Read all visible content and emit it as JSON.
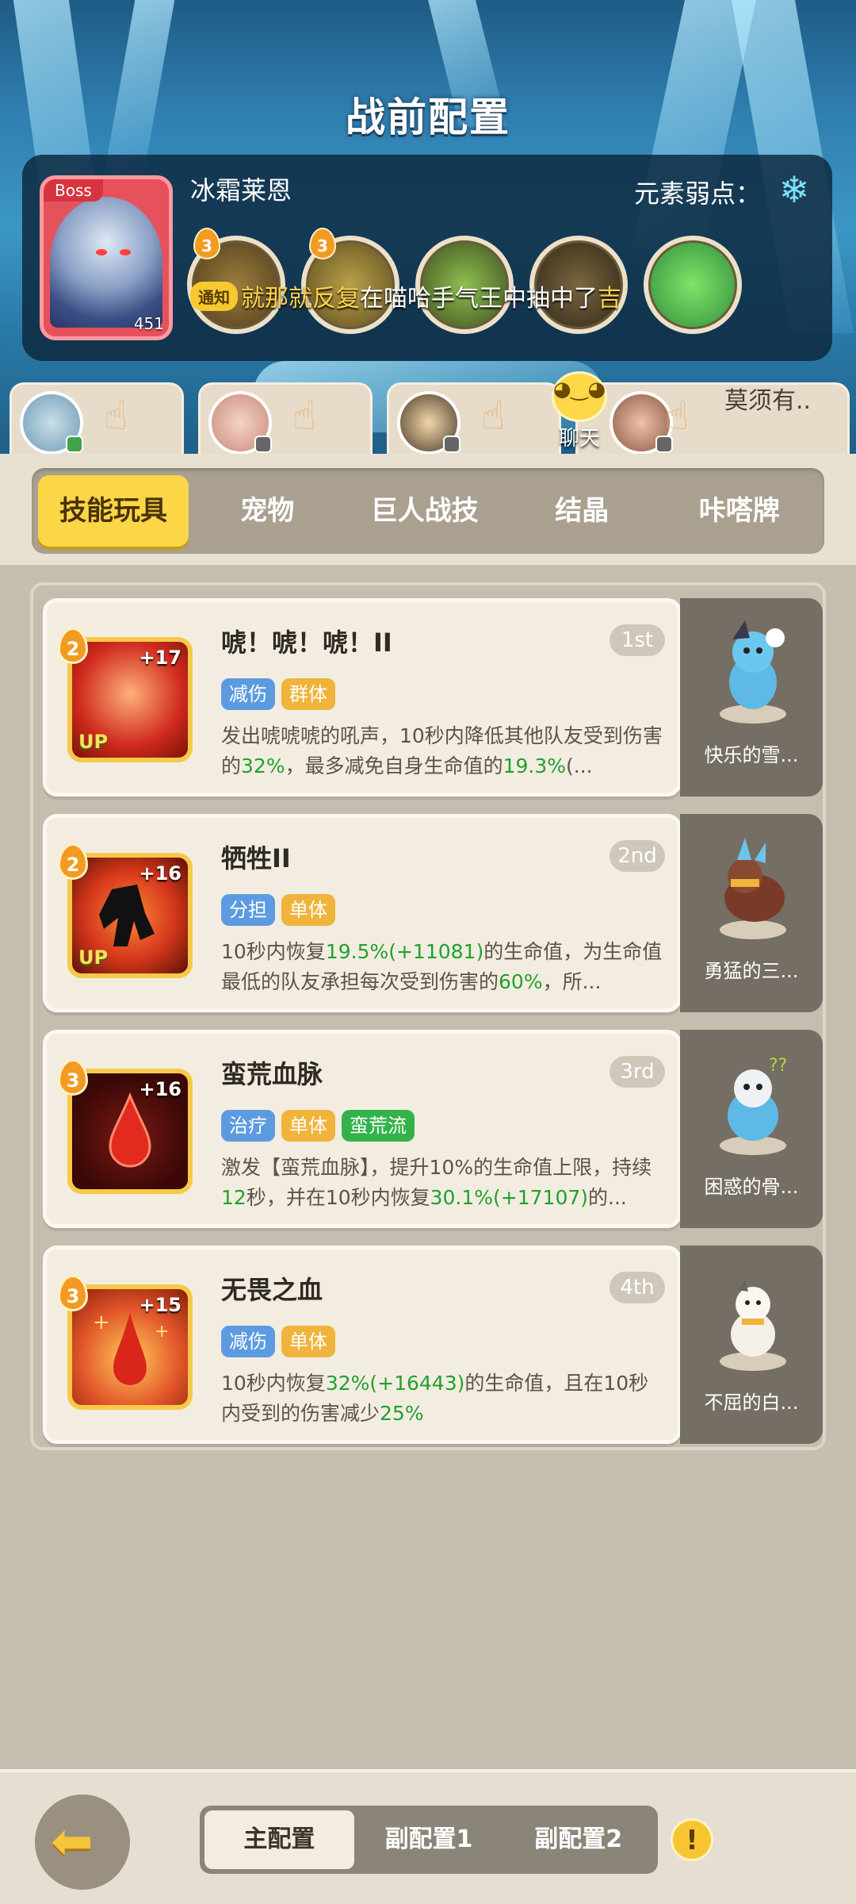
{
  "header": {
    "title": "战前配置"
  },
  "boss": {
    "tag": "Boss",
    "level": "451",
    "name": "冰霜莱恩",
    "weakness_label": "元素弱点：",
    "weakness_icon": "snowflake-icon",
    "skill_badges": [
      "3",
      "3"
    ],
    "notice_tag": "通知",
    "notice_text_a": "就那就反复",
    "notice_text_b": "在喵哈手气王中抽中了",
    "notice_text_c": "吉"
  },
  "team": {
    "chat_label": "聊天",
    "other_label": "莫须有..",
    "tap_icon": "tap-hand-icon"
  },
  "tabs": [
    "技能玩具",
    "宠物",
    "巨人战技",
    "结晶",
    "咔嗒牌"
  ],
  "skills": [
    {
      "level": "2",
      "plus": "+17",
      "up": "UP",
      "name": "唬！唬！唬！II",
      "rank": "1st",
      "tags": [
        "减伤",
        "群体"
      ],
      "desc": [
        "发出唬唬唬的吼声，10秒内降低其他队友受到伤害的",
        "32%",
        "，最多减免自身生命值的",
        "19.3%",
        "(..."
      ],
      "pet": "快乐的雪..."
    },
    {
      "level": "2",
      "plus": "+16",
      "up": "UP",
      "name": "牺牲II",
      "rank": "2nd",
      "tags": [
        "分担",
        "单体"
      ],
      "desc": [
        "10秒内恢复",
        "19.5%(+11081)",
        "的生命值，为生命值最低的队友承担每次受到伤害的",
        "60%",
        "，所..."
      ],
      "pet": "勇猛的三..."
    },
    {
      "level": "3",
      "plus": "+16",
      "up": "",
      "name": "蛮荒血脉",
      "rank": "3rd",
      "tags": [
        "治疗",
        "单体",
        "蛮荒流"
      ],
      "desc": [
        "激发【蛮荒血脉】，提升10%的生命值上限，持续",
        "12",
        "秒，并在10秒内恢复",
        "30.1%(+17107)",
        "的..."
      ],
      "pet": "困惑的骨..."
    },
    {
      "level": "3",
      "plus": "+15",
      "up": "",
      "name": "无畏之血",
      "rank": "4th",
      "tags": [
        "减伤",
        "单体"
      ],
      "desc": [
        "10秒内恢复",
        "32%(+16443)",
        "的生命值，且在10秒内受到的伤害减少",
        "25%",
        ""
      ],
      "pet": "不屈的白..."
    }
  ],
  "bottom": {
    "configs": [
      "主配置",
      "副配置1",
      "副配置2"
    ],
    "warn": "!"
  },
  "colors": {
    "accent_yellow": "#fbd647",
    "highlight_green": "#21a12e",
    "tag_blue": "#5c9be0",
    "tag_orange": "#f0b43c",
    "tag_green": "#33b24a"
  }
}
